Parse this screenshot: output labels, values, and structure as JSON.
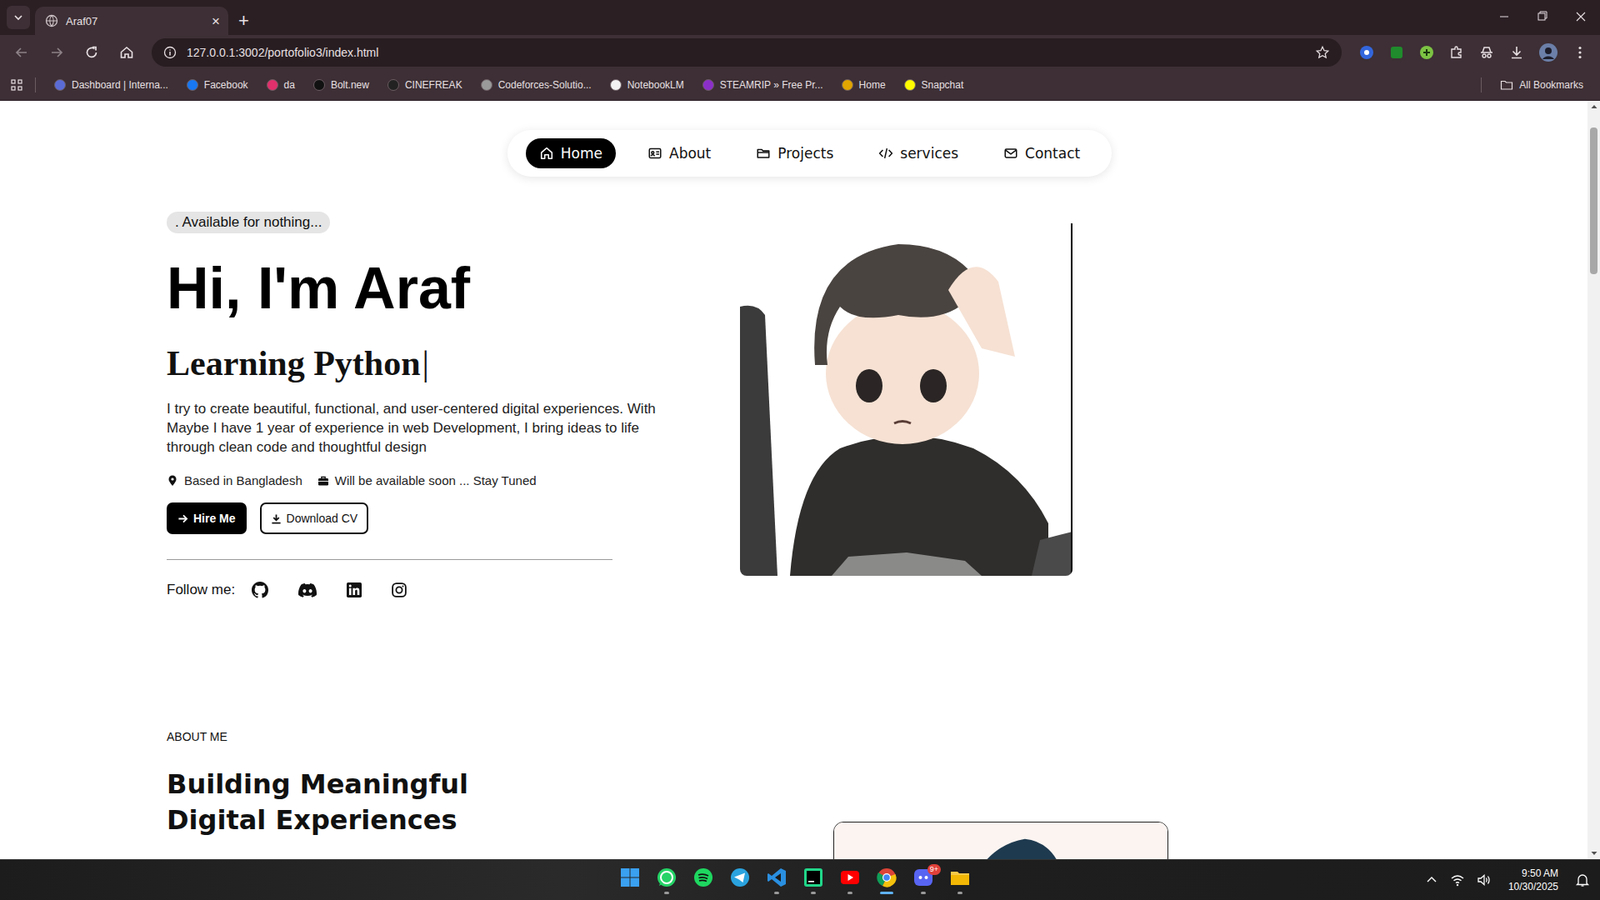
{
  "browser": {
    "tabs": [
      {
        "title": "Araf07",
        "selected": true
      }
    ],
    "close_tab": "×",
    "new_tab": "+",
    "url": "127.0.0.1:3002/portofolio3/index.html",
    "bookmarks": [
      {
        "label": "Dashboard | Interna...",
        "color": "#5b6bd6"
      },
      {
        "label": "Facebook",
        "color": "#1877f2"
      },
      {
        "label": "da",
        "color": "#e1306c"
      },
      {
        "label": "Bolt.new",
        "color": "#111111"
      },
      {
        "label": "CINEFREAK",
        "color": "#222222"
      },
      {
        "label": "Codeforces-Solutio...",
        "color": "#9a9a9a"
      },
      {
        "label": "NotebookLM",
        "color": "#f2f2f2"
      },
      {
        "label": "STEAMRIP » Free Pr...",
        "color": "#8b2fc9"
      },
      {
        "label": "Home",
        "color": "#e0a500"
      },
      {
        "label": "Snapchat",
        "color": "#fffc00"
      }
    ],
    "all_bookmarks": "All Bookmarks",
    "scroll": {
      "offset": 0.02,
      "size": 0.2
    }
  },
  "page": {
    "nav": [
      {
        "label": "Home",
        "selected": true
      },
      {
        "label": "About",
        "selected": false
      },
      {
        "label": "Projects",
        "selected": false
      },
      {
        "label": "services",
        "selected": false
      },
      {
        "label": "Contact",
        "selected": false
      }
    ],
    "badge": ". Available for nothing...",
    "heading": "Hi, I'm Araf",
    "typing": "Learning Python",
    "cursor": "|",
    "bio": "I try to create beautiful, functional, and user-centered digital experiences. With Maybe I have 1 year of experience in web Development, I bring ideas to life through clean code and thoughtful design",
    "meta": [
      {
        "kind": "location",
        "text": "Based in Bangladesh"
      },
      {
        "kind": "work",
        "text": "Will be available soon ... Stay Tuned"
      }
    ],
    "buttons": [
      {
        "label": "Hire Me",
        "kind": "primary"
      },
      {
        "label": "Download CV",
        "kind": "secondary"
      }
    ],
    "follow_label": "Follow me:",
    "about": {
      "eyebrow": "ABOUT ME",
      "title_lines": [
        "Building Meaningful",
        "Digital Experiences"
      ]
    }
  },
  "taskbar": {
    "apps": [
      {
        "running": false,
        "active": false
      },
      {
        "running": true,
        "active": false
      },
      {
        "running": false,
        "active": false
      },
      {
        "running": false,
        "active": false
      },
      {
        "running": true,
        "active": false
      },
      {
        "running": true,
        "active": false
      },
      {
        "running": true,
        "active": false
      },
      {
        "running": true,
        "active": true
      },
      {
        "running": true,
        "active": false
      },
      {
        "running": true,
        "active": false
      }
    ],
    "badge": "9+",
    "time": "9:50 AM",
    "date": "10/30/2025"
  }
}
